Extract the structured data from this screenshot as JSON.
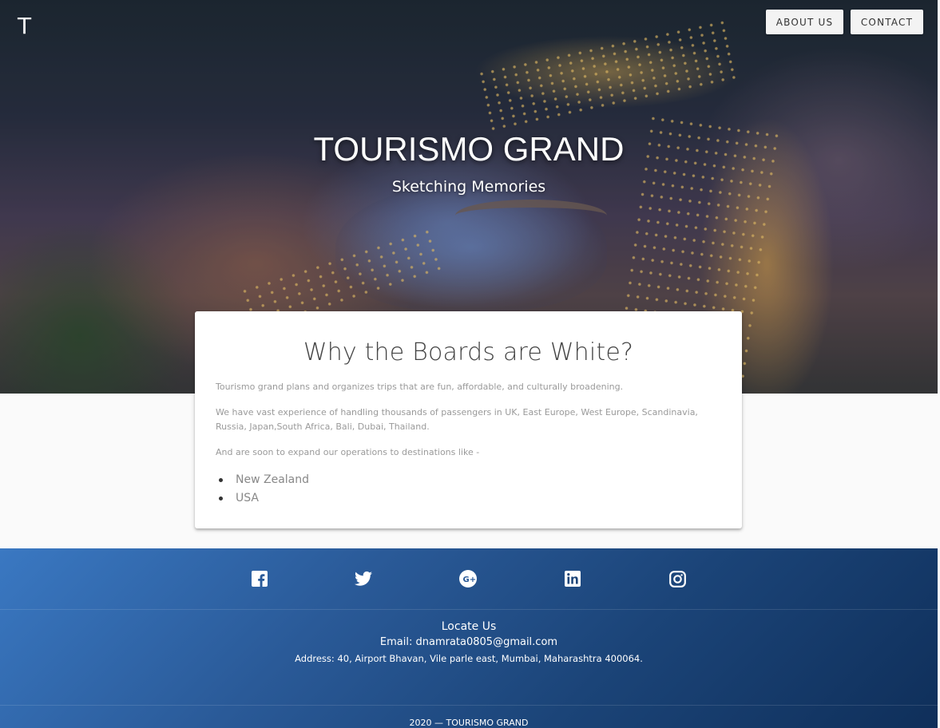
{
  "header": {
    "logo_letter": "T",
    "nav": [
      {
        "label": "ABOUT US"
      },
      {
        "label": "CONTACT"
      }
    ]
  },
  "hero": {
    "title": "TOURISMO GRAND",
    "subtitle": "Sketching Memories"
  },
  "card": {
    "title": "Why the Boards are White?",
    "paragraphs": [
      "Tourismo grand plans and organizes trips that are fun, affordable, and culturally broadening.",
      "We have vast experience of handling thousands of passengers in UK, East Europe, West Europe, Scandinavia, Russia, Japan,South Africa, Bali, Dubai, Thailand.",
      "And are soon to expand our operations to destinations like -"
    ],
    "list": [
      "New Zealand",
      "USA"
    ]
  },
  "footer": {
    "social_icons": [
      "facebook-icon",
      "twitter-icon",
      "google-plus-icon",
      "linkedin-icon",
      "instagram-icon"
    ],
    "locate_heading": "Locate Us",
    "email": "Email: dnamrata0805@gmail.com",
    "address": "Address: 40, Airport Bhavan, Vile parle east, Mumbai, Maharashtra 400064.",
    "copyright": "2020 — TOURISMO GRAND"
  },
  "colors": {
    "footer_gradient_start": "#3a78c2",
    "footer_gradient_end": "#0f2f5a",
    "card_background": "#ffffff",
    "page_background": "#fafafa"
  }
}
